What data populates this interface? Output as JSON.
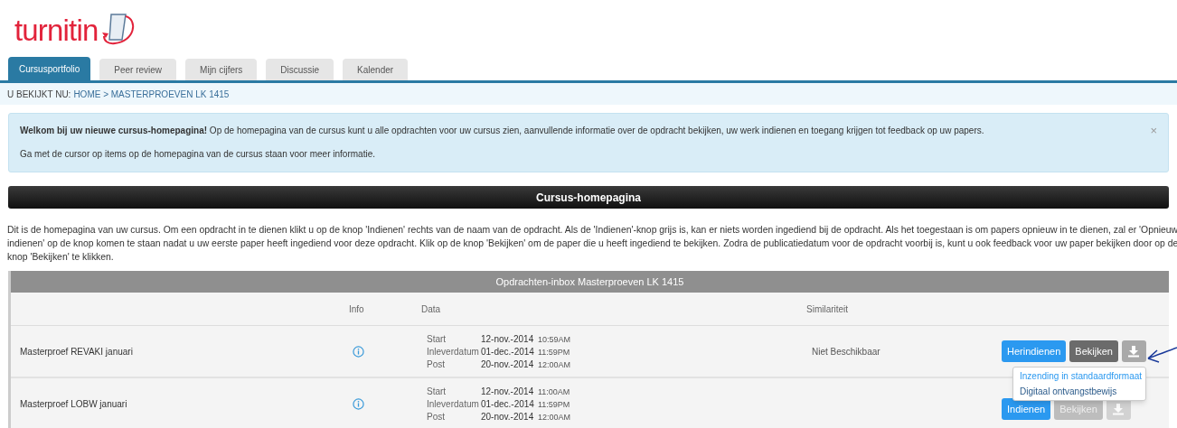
{
  "logo": {
    "text": "turnitin"
  },
  "tabs": [
    {
      "label": "Cursusportfolio",
      "selected": true
    },
    {
      "label": "Peer review",
      "selected": false
    },
    {
      "label": "Mijn cijfers",
      "selected": false
    },
    {
      "label": "Discussie",
      "selected": false
    },
    {
      "label": "Kalender",
      "selected": false
    }
  ],
  "breadcrumb": {
    "prefix": "U BEKIJKT NU:",
    "path": "HOME > MASTERPROEVEN LK 1415"
  },
  "alert": {
    "text": "**Welkom bij uw nieuwe cursus-homepagina!** Op de homepagina van de cursus kunt u alle opdrachten voor uw cursus zien, aanvullende informatie over de opdracht bekijken, uw werk indienen en toegang krijgen tot feedback op uw papers.",
    "hint": "Ga met de cursor op items op de homepagina van de cursus staan voor meer informatie.",
    "close": "×"
  },
  "section_title": "Cursus-homepagina",
  "intro": "Dit is de homepagina van uw cursus. Om een opdracht in te dienen klikt u op de knop 'Indienen' rechts van de naam van de opdracht. Als de 'Indienen'-knop grijs is, kan er niets worden ingediend bij de opdracht. Als het toegestaan is om papers opnieuw in te dienen, zal er 'Opnieuw indienen' op de knop komen te staan nadat u uw eerste paper heeft ingediend voor deze opdracht. Klik op de knop 'Bekijken' om de paper die u heeft ingediend te bekijken. Zodra de publicatiedatum voor de opdracht voorbij is, kunt u ook feedback voor uw paper bekijken door op de knop 'Bekijken' te klikken.",
  "inbox": {
    "title": "Opdrachten-inbox Masterproeven LK 1415",
    "columns": [
      "Info",
      "Data",
      "Similariteit"
    ],
    "rows": [
      {
        "name": "Masterproef REVAKI januari",
        "dates": [
          {
            "label": "Start",
            "date": "12-nov.-2014",
            "time": "10:59AM"
          },
          {
            "label": "Inleverdatum",
            "date": "01-dec.-2014",
            "time": "11:59PM"
          },
          {
            "label": "Post",
            "date": "20-nov.-2014",
            "time": "12:00AM"
          }
        ],
        "similarity": "Niet Beschikbaar",
        "submit": "Herindienen",
        "view": "Bekijken",
        "view_disabled": false,
        "download_disabled": false
      },
      {
        "name": "Masterproef LOBW januari",
        "dates": [
          {
            "label": "Start",
            "date": "12-nov.-2014",
            "time": "11:00AM"
          },
          {
            "label": "Inleverdatum",
            "date": "01-dec.-2014",
            "time": "11:59PM"
          },
          {
            "label": "Post",
            "date": "20-nov.-2014",
            "time": "12:00AM"
          }
        ],
        "submit": "Indienen",
        "view": "Bekijken",
        "view_disabled": true,
        "download_disabled": true
      }
    ]
  },
  "download_menu": {
    "items": [
      {
        "label": "Inzending in standaardformaat",
        "selected": true
      },
      {
        "label": "Digitaal ontvangstbewijs",
        "selected": false
      }
    ]
  }
}
